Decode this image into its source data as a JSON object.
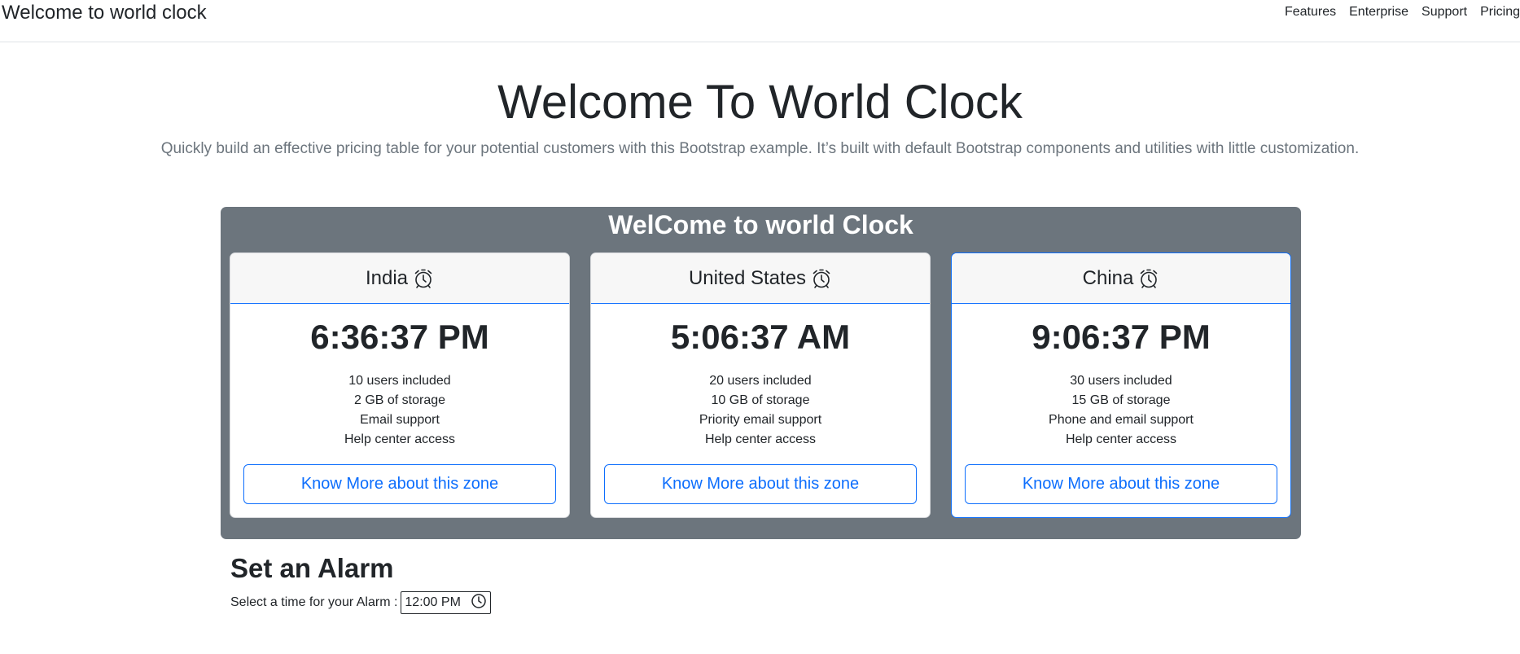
{
  "navbar": {
    "brand": "Welcome to world clock",
    "links": [
      "Features",
      "Enterprise",
      "Support",
      "Pricing"
    ]
  },
  "hero": {
    "title": "Welcome To World Clock",
    "lead": "Quickly build an effective pricing table for your potential customers with this Bootstrap example. It’s built with default Bootstrap components and utilities with little customization."
  },
  "panel": {
    "title": "WelCome to world Clock",
    "cards": [
      {
        "name": "India",
        "time": "6:36:37 PM",
        "features": [
          "10 users included",
          "2 GB of storage",
          "Email support",
          "Help center access"
        ],
        "button": "Know More about this zone"
      },
      {
        "name": "United States",
        "time": "5:06:37 AM",
        "features": [
          "20 users included",
          "10 GB of storage",
          "Priority email support",
          "Help center access"
        ],
        "button": "Know More about this zone"
      },
      {
        "name": "China",
        "time": "9:06:37 PM",
        "features": [
          "30 users included",
          "15 GB of storage",
          "Phone and email support",
          "Help center access"
        ],
        "button": "Know More about this zone"
      }
    ]
  },
  "alarm": {
    "title": "Set an Alarm",
    "label": "Select a time for your Alarm :",
    "value": "12:00 PM"
  },
  "colors": {
    "primary": "#0d6efd",
    "panel_bg": "#6c757d",
    "text": "#212529",
    "muted": "#6c757d"
  },
  "icons": {
    "card_header": "alarm-clock-icon",
    "time_input": "clock-icon"
  }
}
